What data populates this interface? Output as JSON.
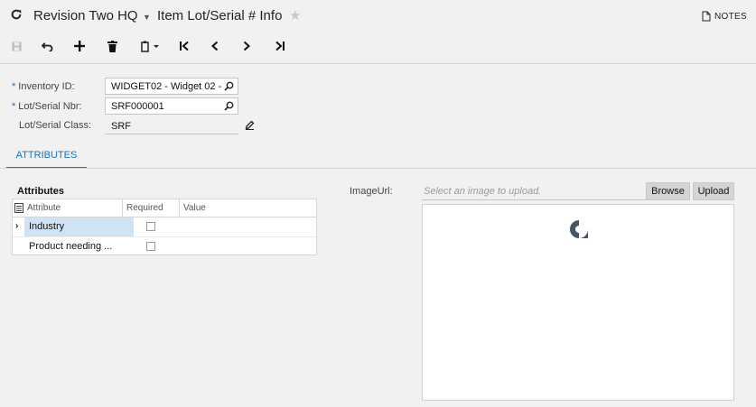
{
  "header": {
    "company": "Revision Two HQ",
    "screen_title": "Item Lot/Serial # Info",
    "notes_label": "NOTES"
  },
  "toolbar": {
    "items": [
      "save-icon",
      "undo-icon",
      "add-icon",
      "delete-icon",
      "copy-paste-icon",
      "first-icon",
      "prev-icon",
      "next-icon",
      "last-icon"
    ]
  },
  "form": {
    "inventory_id_label": "Inventory ID:",
    "inventory_id_value": "WIDGET02 - Widget 02 - :",
    "lot_serial_nbr_label": "Lot/Serial Nbr:",
    "lot_serial_nbr_value": "SRF000001",
    "lot_serial_class_label": "Lot/Serial Class:",
    "lot_serial_class_value": "SRF",
    "required_mark": "*"
  },
  "tabs": [
    {
      "label": "ATTRIBUTES",
      "active": true
    }
  ],
  "attributes_grid": {
    "title": "Attributes",
    "columns": [
      "Attribute",
      "Required",
      "Value"
    ],
    "rows": [
      {
        "attribute": "Industry",
        "required": false,
        "value": "",
        "selected": true
      },
      {
        "attribute": "Product needing ...",
        "required": false,
        "value": "",
        "selected": false
      }
    ]
  },
  "image": {
    "label": "ImageUrl:",
    "placeholder": "Select an image to upload.",
    "browse_label": "Browse",
    "upload_label": "Upload"
  },
  "colors": {
    "accent": "#1a72b8",
    "selected_row": "#cfe3f5",
    "background": "#f1f1f1"
  }
}
